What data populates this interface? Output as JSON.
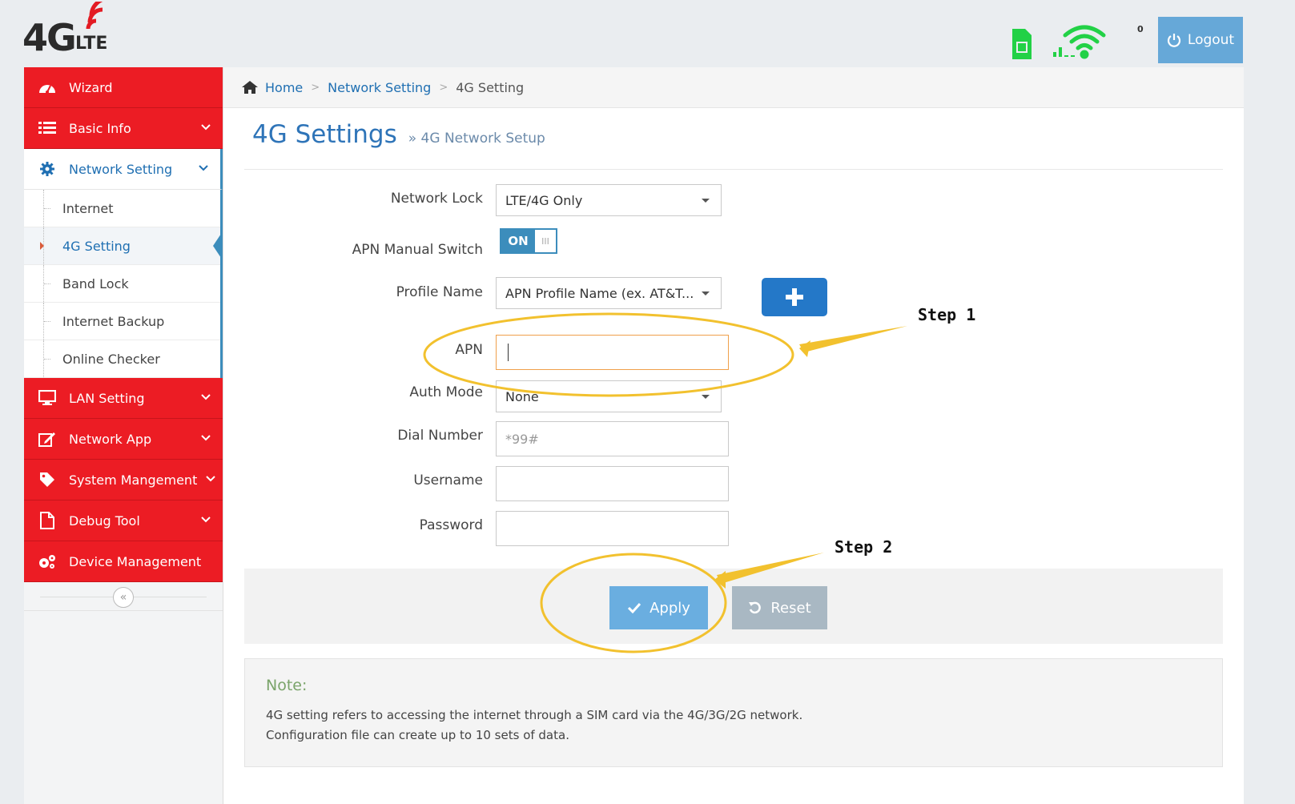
{
  "header": {
    "logo_main": "4G",
    "logo_sub": "LTE",
    "wifi_count": "0",
    "logout_label": "Logout"
  },
  "sidebar": {
    "items": [
      {
        "label": "Wizard",
        "icon": "dashboard-icon"
      },
      {
        "label": "Basic Info",
        "icon": "list-icon"
      },
      {
        "label": "Network Setting",
        "icon": "gear-icon"
      },
      {
        "label": "LAN Setting",
        "icon": "monitor-icon"
      },
      {
        "label": "Network App",
        "icon": "edit-icon"
      },
      {
        "label": "System Mangement",
        "icon": "tag-icon"
      },
      {
        "label": "Debug Tool",
        "icon": "file-icon"
      },
      {
        "label": "Device Management",
        "icon": "gears-icon"
      }
    ],
    "sub_items": [
      "Internet",
      "4G Setting",
      "Band Lock",
      "Internet Backup",
      "Online Checker"
    ],
    "collapse_glyph": "«"
  },
  "breadcrumb": {
    "home": "Home",
    "section": "Network Setting",
    "current": "4G Setting"
  },
  "page": {
    "title": "4G Settings",
    "subtitle": "» 4G Network Setup"
  },
  "form": {
    "network_lock_label": "Network Lock",
    "network_lock_value": "LTE/4G Only",
    "apn_switch_label": "APN Manual Switch",
    "apn_switch_on": "ON",
    "apn_switch_off": "III",
    "profile_label": "Profile Name",
    "profile_value": "APN Profile Name (ex. AT&T...",
    "apn_label": "APN",
    "apn_value": "",
    "auth_label": "Auth Mode",
    "auth_value": "None",
    "dial_label": "Dial Number",
    "dial_placeholder": "*99#",
    "username_label": "Username",
    "password_label": "Password"
  },
  "actions": {
    "apply": "Apply",
    "reset": "Reset"
  },
  "note": {
    "title": "Note:",
    "lines": [
      "4G setting refers to accessing the internet through a SIM card via the 4G/3G/2G network.",
      "Configuration file can create up to 10 sets of data."
    ]
  },
  "annotations": {
    "step1": "Step 1",
    "step2": "Step 2"
  },
  "colors": {
    "menu_red": "#ec1c24",
    "accent_blue": "#2e74b8",
    "annotation_yellow": "#f2c12e",
    "signal_green": "#22d146"
  }
}
